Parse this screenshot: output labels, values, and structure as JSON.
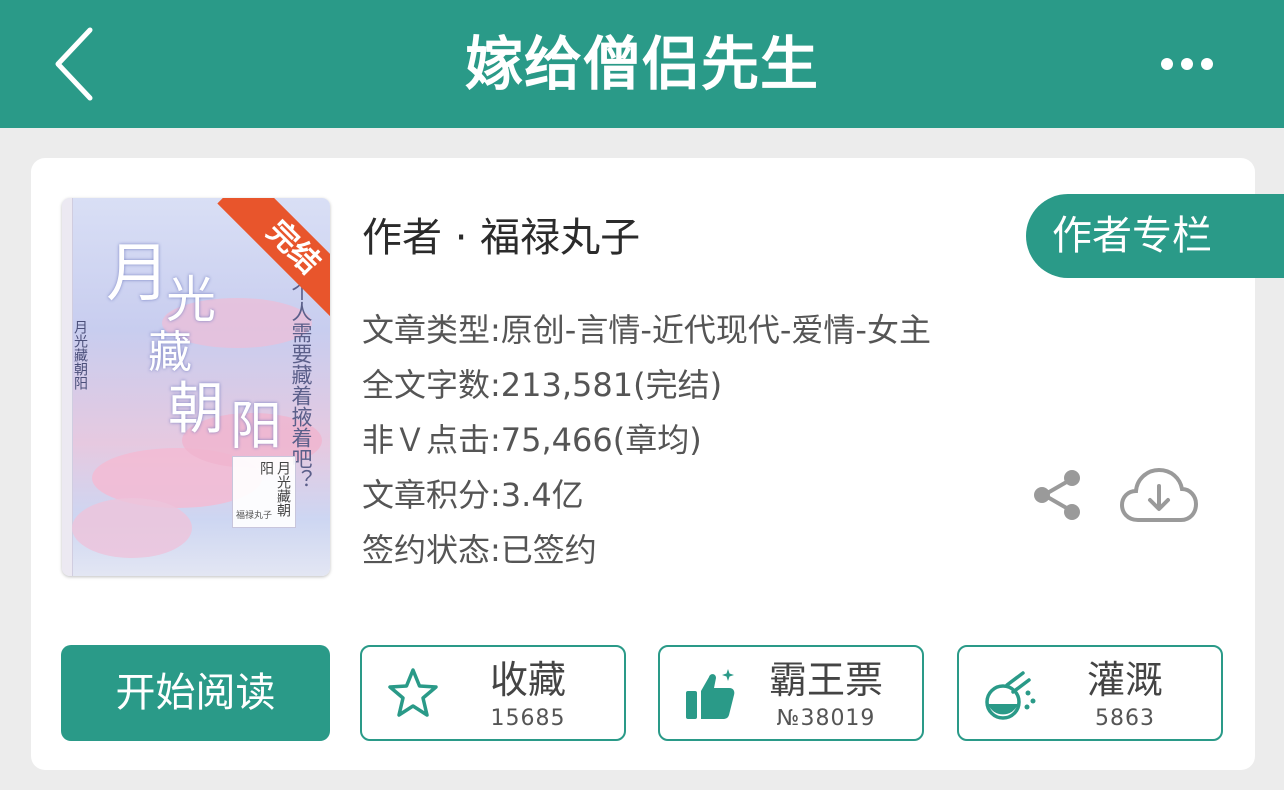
{
  "header": {
    "title": "嫁给僧侣先生",
    "back_icon": "chevron-left-icon",
    "more_icon": "more-dots-icon",
    "background_color": "#2a9a88"
  },
  "book": {
    "cover": {
      "badge": "完结",
      "title_chars": [
        "月",
        "光",
        "藏",
        "朝",
        "阳"
      ],
      "tagline": "爱一个人需要藏着掖着吧？",
      "small_title": "月光藏朝阳",
      "label_title": "月光藏朝阳",
      "author": "福禄丸子"
    },
    "author_line": "作者 · 福禄丸子",
    "column_button": "作者专栏",
    "info": {
      "category": "文章类型:原创-言情-近代现代-爱情-女主",
      "word_count": "全文字数:213,581(完结)",
      "clicks": "非Ｖ点击:75,466(章均)",
      "score": "文章积分:3.4亿",
      "sign_status": "签约状态:已签约"
    },
    "share_icon": "share-icon",
    "download_icon": "cloud-download-icon"
  },
  "actions": {
    "read": "开始阅读",
    "favorite": {
      "label": "收藏",
      "count": "15685",
      "icon": "star-icon"
    },
    "ticket": {
      "label": "霸王票",
      "count": "№38019",
      "icon": "thumbs-up-icon"
    },
    "nutrient": {
      "label": "灌溉",
      "count": "5863",
      "icon": "flask-icon"
    }
  },
  "colors": {
    "accent": "#2a9a88",
    "badge": "#e8552c",
    "text": "#555555"
  }
}
